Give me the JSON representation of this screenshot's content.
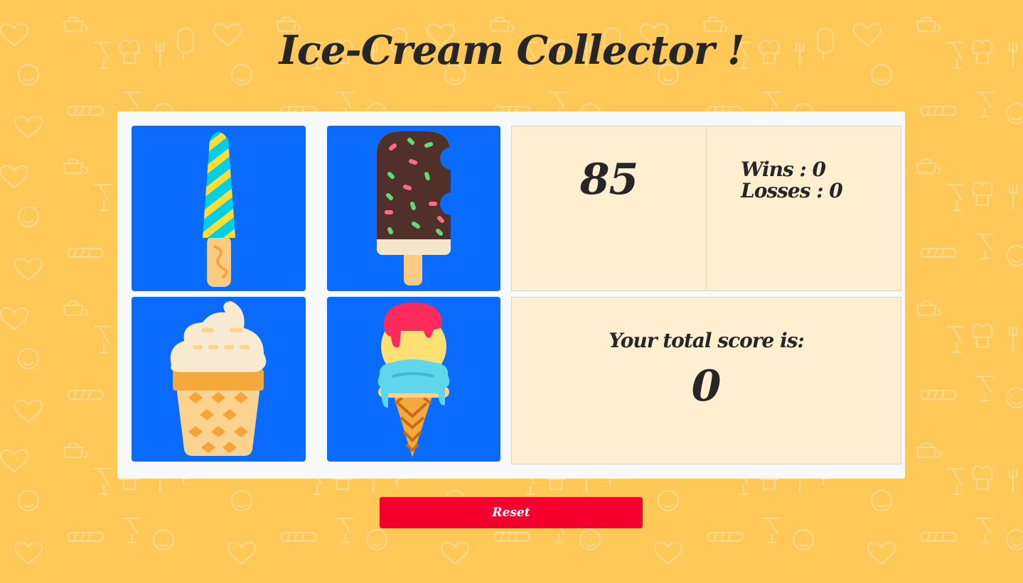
{
  "title": "Ice-Cream Collector !",
  "colors": {
    "background": "#ffc857",
    "panel": "#f8f9fa",
    "tile": "#0a6cff",
    "info_cell": "#ffeecf",
    "reset": "#f5002e"
  },
  "tiles": [
    {
      "icon": "striped-popsicle-icon"
    },
    {
      "icon": "chocolate-sprinkle-popsicle-icon"
    },
    {
      "icon": "soft-serve-cone-icon"
    },
    {
      "icon": "triple-scoop-cone-icon"
    }
  ],
  "target_number": "85",
  "record": {
    "wins": "Wins : 0",
    "losses": "Losses : 0"
  },
  "score": {
    "label": "Your total score is:",
    "value": "0"
  },
  "reset_label": "Reset"
}
